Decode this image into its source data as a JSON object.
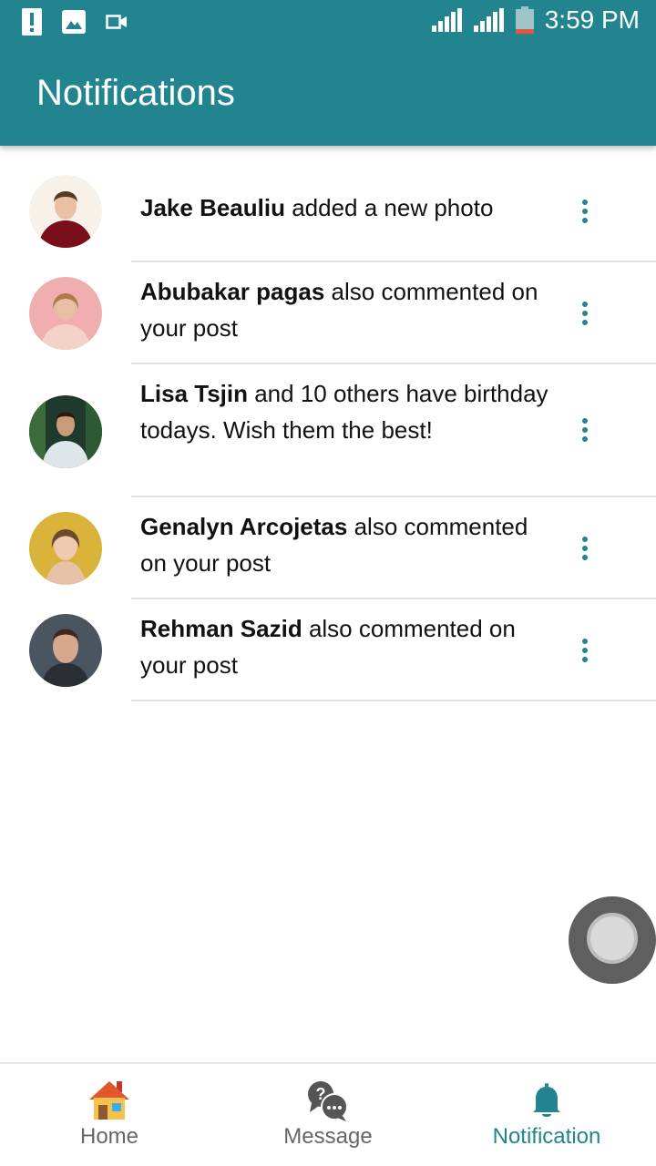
{
  "status_bar": {
    "time": "3:59 PM",
    "icons": [
      "alert-icon",
      "image-icon",
      "video-icon",
      "signal-icon",
      "signal-icon",
      "battery-icon"
    ]
  },
  "header": {
    "title": "Notifications"
  },
  "notifications": [
    {
      "name": "Jake Beauliu",
      "message": " added a new photo",
      "avatar_color": "#7a0f1c"
    },
    {
      "name": "Abubakar pagas",
      "message": " also commented on your post",
      "avatar_color": "#f1aeb0"
    },
    {
      "name": "Lisa Tsjin",
      "message": " and 10 others have birthday todays. Wish them the best!",
      "avatar_color": "#1f3a2c"
    },
    {
      "name": "Genalyn Arcojetas",
      "message": " also commented on your post",
      "avatar_color": "#d9b33a"
    },
    {
      "name": "Rehman Sazid",
      "message": " also commented on your post",
      "avatar_color": "#4a5560"
    }
  ],
  "bottom_nav": {
    "items": [
      {
        "label": "Home",
        "icon": "home-icon"
      },
      {
        "label": "Message",
        "icon": "message-icon"
      },
      {
        "label": "Notification",
        "icon": "bell-icon"
      }
    ],
    "active_index": 2
  },
  "colors": {
    "accent": "#21848f",
    "divider": "#e0e0e0"
  }
}
